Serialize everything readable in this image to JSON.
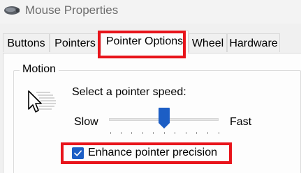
{
  "window": {
    "title": "Mouse Properties",
    "icon": "mouse-icon"
  },
  "tabs": [
    {
      "label": "Buttons",
      "active": false
    },
    {
      "label": "Pointers",
      "active": false
    },
    {
      "label": "Pointer Options",
      "active": true
    },
    {
      "label": "Wheel",
      "active": false
    },
    {
      "label": "Hardware",
      "active": false
    }
  ],
  "motion": {
    "group_label": "Motion",
    "icon": "pointer-speed-icon",
    "speed_prompt": "Select a pointer speed:",
    "slow_label": "Slow",
    "fast_label": "Fast",
    "speed_level": 0.5,
    "enhance_precision": {
      "label": "Enhance pointer precision",
      "checked": true
    }
  },
  "colors": {
    "highlight": "#e8141b",
    "accent": "#1c5ec5"
  }
}
